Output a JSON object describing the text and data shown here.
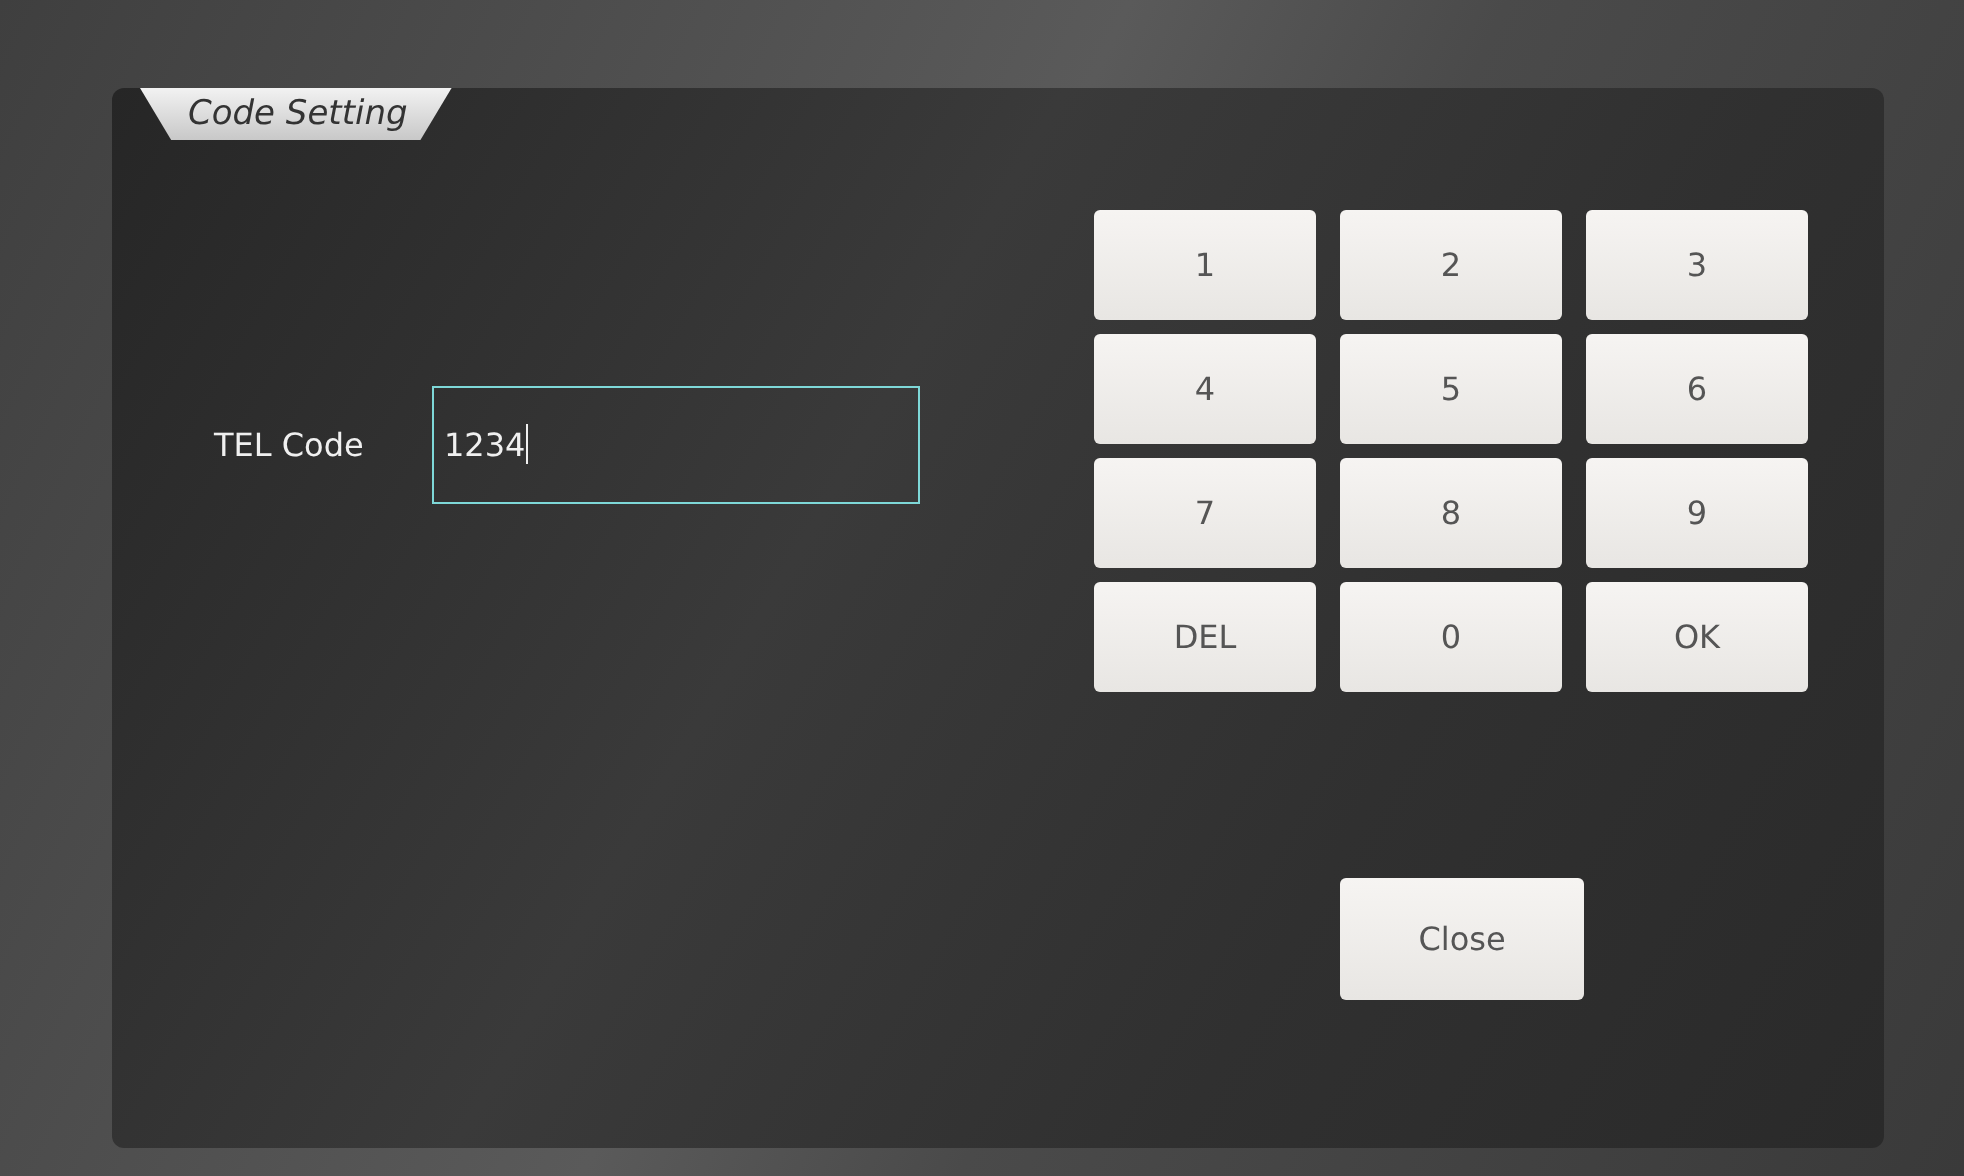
{
  "dialog": {
    "title": "Code Setting"
  },
  "field": {
    "label": "TEL Code",
    "value": "1234",
    "focused": true
  },
  "keypad": [
    {
      "label": "1"
    },
    {
      "label": "2"
    },
    {
      "label": "3"
    },
    {
      "label": "4"
    },
    {
      "label": "5"
    },
    {
      "label": "6"
    },
    {
      "label": "7"
    },
    {
      "label": "8"
    },
    {
      "label": "9"
    },
    {
      "label": "DEL"
    },
    {
      "label": "0"
    },
    {
      "label": "OK"
    }
  ],
  "close_button": {
    "label": "Close"
  }
}
